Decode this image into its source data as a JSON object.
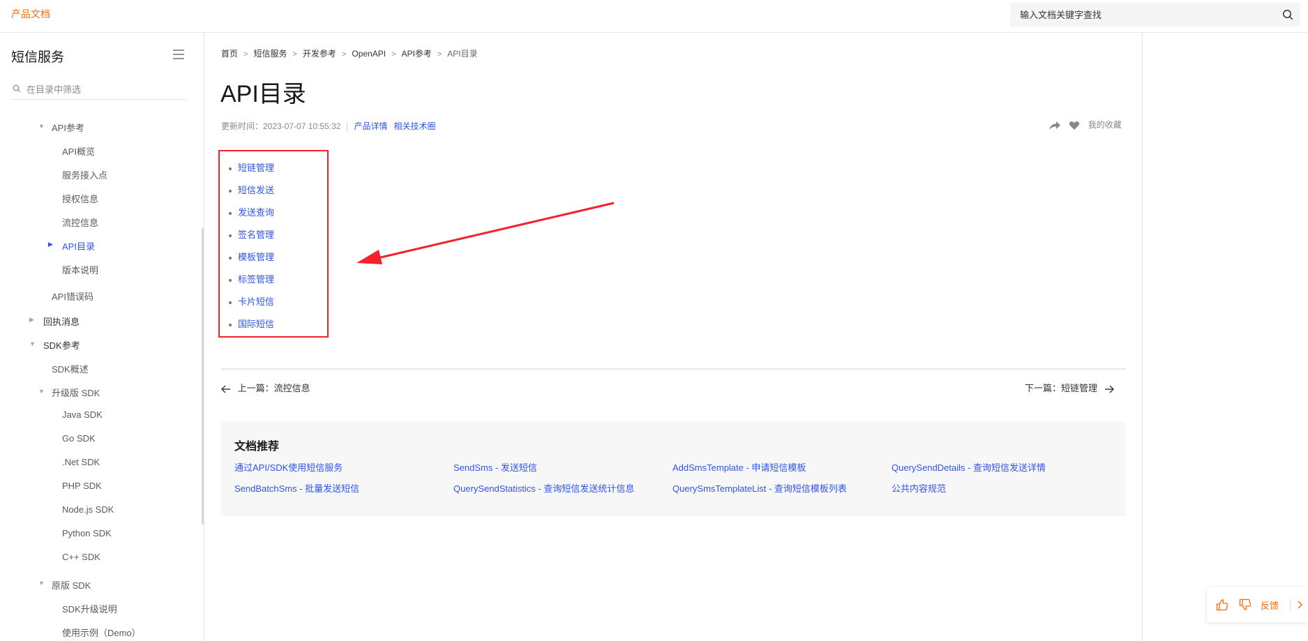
{
  "header": {
    "brand": "产品文档",
    "search_placeholder": "输入文档关键字查找"
  },
  "sidebar": {
    "title": "短信服务",
    "filter_placeholder": "在目录中筛选",
    "items": [
      {
        "label": "API参考",
        "caret": "down"
      },
      {
        "label": "API概览"
      },
      {
        "label": "服务接入点"
      },
      {
        "label": "授权信息"
      },
      {
        "label": "流控信息"
      },
      {
        "label": "API目录",
        "caret": "right",
        "active": true
      },
      {
        "label": "版本说明"
      },
      {
        "label": "API错误码"
      },
      {
        "label": "回执消息",
        "caret": "right"
      },
      {
        "label": "SDK参考",
        "caret": "down"
      },
      {
        "label": "SDK概述"
      },
      {
        "label": "升级版 SDK",
        "caret": "down"
      },
      {
        "label": "Java SDK"
      },
      {
        "label": "Go SDK"
      },
      {
        "label": ".Net SDK"
      },
      {
        "label": "PHP SDK"
      },
      {
        "label": "Node.js SDK"
      },
      {
        "label": "Python SDK"
      },
      {
        "label": "C++ SDK"
      },
      {
        "label": "原版 SDK",
        "caret": "down"
      },
      {
        "label": "SDK升级说明"
      },
      {
        "label": "使用示例（Demo）"
      }
    ]
  },
  "breadcrumb": [
    "首页",
    "短信服务",
    "开发参考",
    "OpenAPI",
    "API参考",
    "API目录"
  ],
  "page": {
    "title": "API目录",
    "updated": "更新时间：2023-07-07 10:55:32",
    "link_product": "产品详情",
    "link_community": "相关技术圈",
    "favorite_label": "我的收藏"
  },
  "api_list": [
    "短链管理",
    "短信发送",
    "发送查询",
    "签名管理",
    "模板管理",
    "标签管理",
    "卡片短信",
    "国际短信"
  ],
  "nav": {
    "prev": "上一篇：流控信息",
    "next": "下一篇：短链管理"
  },
  "recommend": {
    "title": "文档推荐",
    "links": [
      "通过API/SDK使用短信服务",
      "SendSms - 发送短信",
      "AddSmsTemplate - 申请短信模板",
      "QuerySendDetails - 查询短信发送详情",
      "SendBatchSms - 批量发送短信",
      "QuerySendStatistics - 查询短信发送统计信息",
      "QuerySmsTemplateList - 查询短信模板列表",
      "公共内容规范"
    ]
  },
  "feedback": {
    "label": "反馈"
  },
  "colors": {
    "brand": "#ff6a00",
    "link": "#2f54eb",
    "highlight_box": "#f5222d"
  }
}
